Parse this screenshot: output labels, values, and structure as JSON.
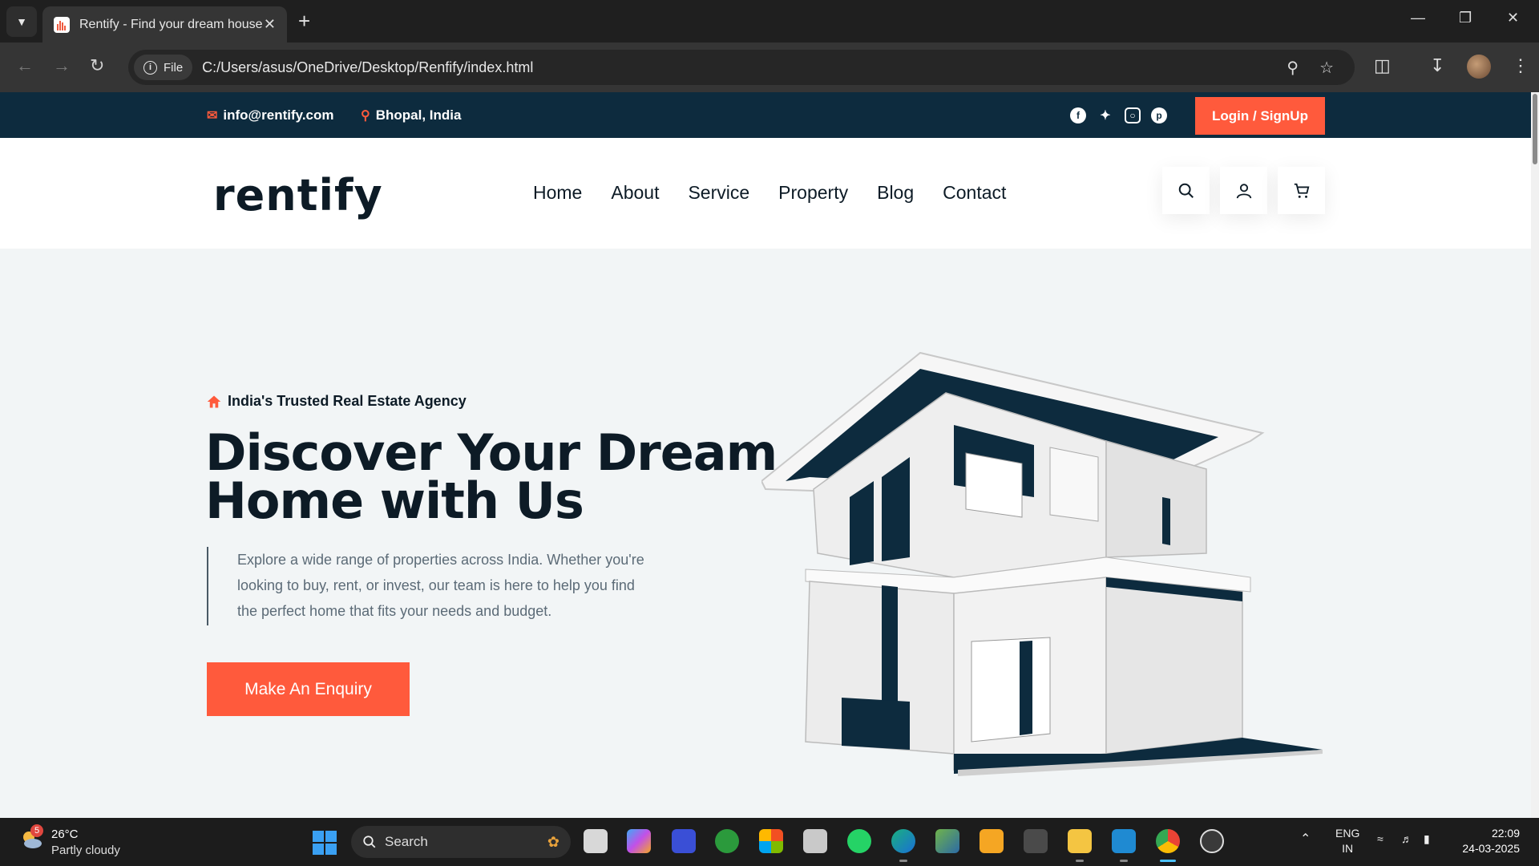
{
  "browser": {
    "tab_title": "Rentify - Find your dream house",
    "chip_label": "File",
    "url": "C:/Users/asus/OneDrive/Desktop/Renfify/index.html"
  },
  "topbar": {
    "email": "info@rentify.com",
    "location": "Bhopal, India",
    "social": [
      "facebook-icon",
      "twitter-icon",
      "instagram-icon",
      "pinterest-icon"
    ],
    "login_label": "Login / SignUp"
  },
  "header": {
    "logo": "rentify",
    "nav": [
      "Home",
      "About",
      "Service",
      "Property",
      "Blog",
      "Contact"
    ]
  },
  "hero": {
    "tagline": "India's Trusted Real Estate Agency",
    "title": "Discover Your Dream Home with Us",
    "description": "Explore a wide range of properties across India. Whether you're looking to buy, rent, or invest, our team is here to help you find the perfect home that fits your needs and budget.",
    "cta_label": "Make An Enquiry"
  },
  "colors": {
    "accent": "#ff5a3c",
    "navy": "#0d2b3e",
    "hero_bg": "#f2f5f6"
  },
  "taskbar": {
    "weather_temp": "26°C",
    "weather_desc": "Partly cloudy",
    "weather_badge": "5",
    "search_label": "Search",
    "lang_line1": "ENG",
    "lang_line2": "IN",
    "time": "22:09",
    "date": "24-03-2025"
  }
}
